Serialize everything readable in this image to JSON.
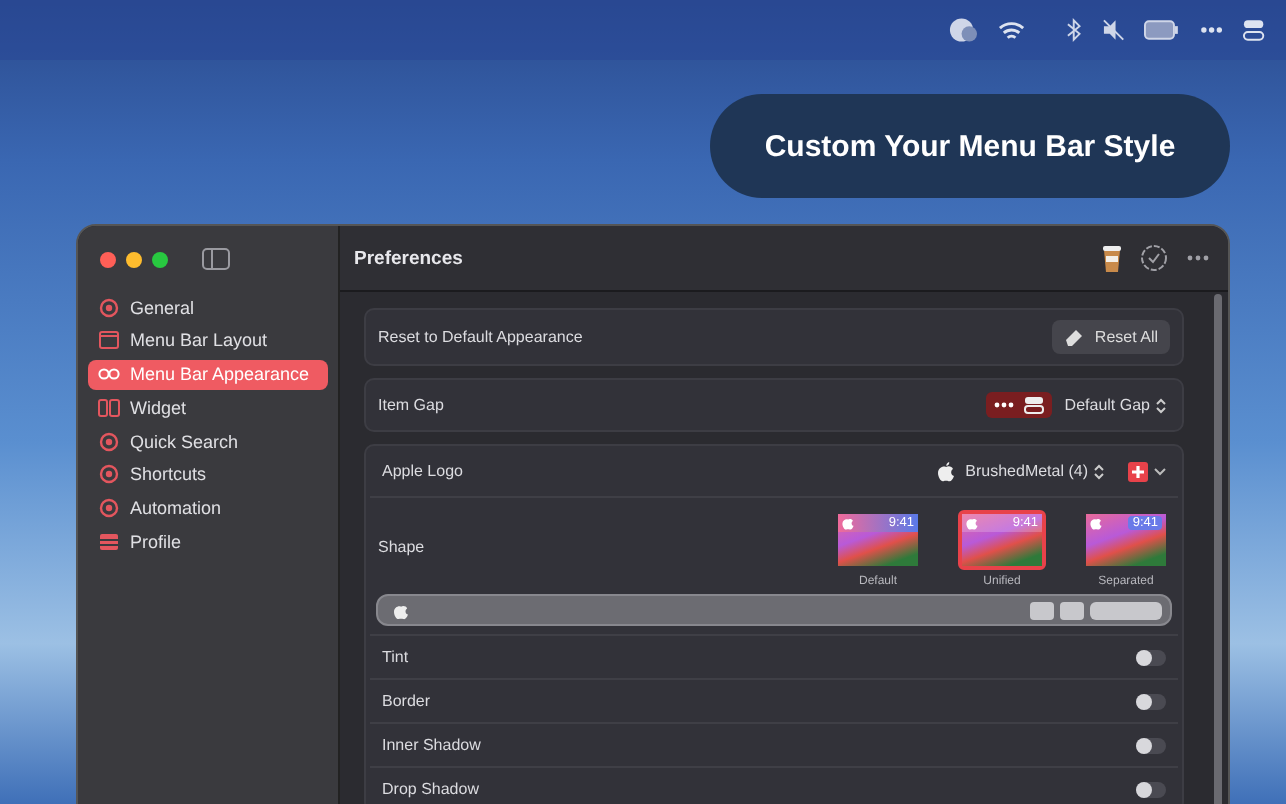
{
  "banner": {
    "text": "Custom Your Menu Bar Style"
  },
  "window": {
    "title": "Preferences"
  },
  "sidebar": {
    "items": [
      {
        "label": "General",
        "selected": false
      },
      {
        "label": "Menu Bar Layout",
        "selected": false
      },
      {
        "label": "Menu Bar Appearance",
        "selected": true
      },
      {
        "label": "Widget",
        "selected": false
      },
      {
        "label": "Quick Search",
        "selected": false
      },
      {
        "label": "Shortcuts",
        "selected": false
      },
      {
        "label": "Automation",
        "selected": false
      },
      {
        "label": "Profile",
        "selected": false
      }
    ]
  },
  "reset": {
    "label": "Reset to Default Appearance",
    "button": "Reset All"
  },
  "item_gap": {
    "label": "Item Gap",
    "value": "Default Gap"
  },
  "apple_logo": {
    "label": "Apple Logo",
    "value": "BrushedMetal (4)"
  },
  "shape": {
    "label": "Shape",
    "options": [
      {
        "label": "Default",
        "time": "9:41",
        "selected": false
      },
      {
        "label": "Unified",
        "time": "9:41",
        "selected": true
      },
      {
        "label": "Separated",
        "time": "9:41",
        "selected": false
      }
    ]
  },
  "toggles": [
    {
      "label": "Tint",
      "on": false
    },
    {
      "label": "Border",
      "on": false
    },
    {
      "label": "Inner Shadow",
      "on": false
    },
    {
      "label": "Drop Shadow",
      "on": false
    }
  ]
}
